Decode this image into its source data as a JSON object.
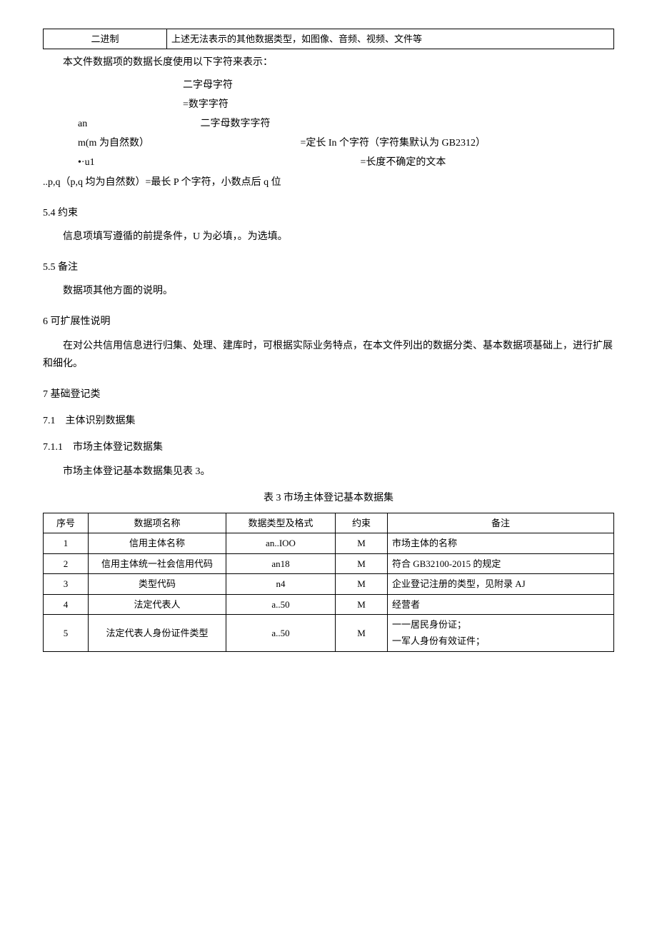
{
  "top_table": {
    "col1": "二进制",
    "col2": "上述无法表示的其他数据类型，如图像、音频、视频、文件等"
  },
  "length_intro": "本文件数据项的数据长度使用以下字符来表示：",
  "len1": "二字母字符",
  "len2": "=数字字符",
  "len3_left": "an",
  "len3_right": "二字母数字字符",
  "len4_left": "m(m 为自然数）",
  "len4_right": "=定长 In 个字符（字符集默认为 GB2312）",
  "len5_left": "•·u1",
  "len5_right": "=长度不确定的文本",
  "len6": "..p,q（p,q 均为自然数）=最长 P 个字符，小数点后 q 位",
  "s54_title": "5.4 约束",
  "s54_body": "信息项填写遵循的前提条件，U 为必填，。为选填。",
  "s55_title": "5.5 备注",
  "s55_body": "数据项其他方面的说明。",
  "s6_title": "6 可扩展性说明",
  "s6_body": "在对公共信用信息进行归集、处理、建库时，可根据实际业务特点，在本文件列出的数据分类、基本数据项基础上，进行扩展和细化。",
  "s7_title": "7 基础登记类",
  "s71_title": "7.1 主体识别数据集",
  "s711_title": "7.1.1 市场主体登记数据集",
  "s711_body": "市场主体登记基本数据集见表 3。",
  "table3_caption": "表 3 市场主体登记基本数据集",
  "table3": {
    "header": [
      "序号",
      "数据项名称",
      "数据类型及格式",
      "约束",
      "备注"
    ],
    "rows": [
      [
        "1",
        "信用主体名称",
        "an..IOO",
        "M",
        "市场主体的名称"
      ],
      [
        "2",
        "信用主体统一社会信用代码",
        "an18",
        "M",
        "符合 GB32100-2015 的规定"
      ],
      [
        "3",
        "类型代码",
        "n4",
        "M",
        "企业登记注册的类型，见附录 AJ"
      ],
      [
        "4",
        "法定代表人",
        "a..50",
        "M",
        "经营者"
      ],
      [
        "5",
        "法定代表人身份证件类型",
        "a..50",
        "M",
        "一一居民身份证；\n一军人身份有效证件；"
      ]
    ]
  }
}
